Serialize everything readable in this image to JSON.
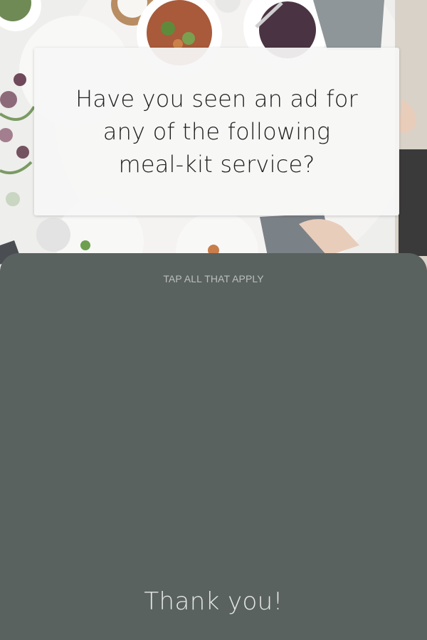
{
  "hero": {
    "image": "food-table-photo"
  },
  "question": {
    "text": "Have you seen an ad for any of the following meal-kit service?"
  },
  "answers": {
    "instruction": "TAP ALL THAT APPLY",
    "options": []
  },
  "footer": {
    "thank_you": "Thank you!"
  },
  "colors": {
    "panel": "#5a625f",
    "card": "#f6f6f6",
    "question_text": "#1f1f1f",
    "instruction_text": "#b9bfbc",
    "thank_you_text": "#e4e7e5"
  }
}
